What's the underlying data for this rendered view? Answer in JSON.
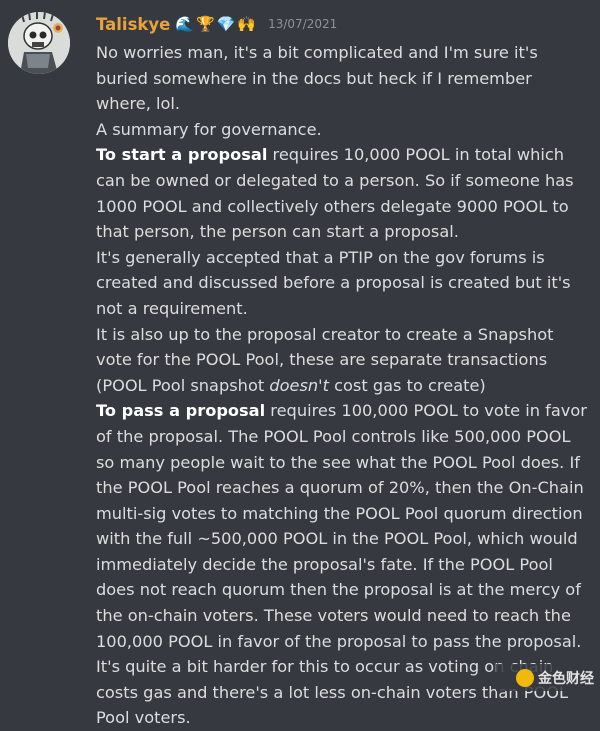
{
  "message": {
    "username": "Taliskye",
    "badges": [
      "🌊",
      "🏆",
      "💎",
      "🙌"
    ],
    "timestamp": "13/07/2021",
    "colors": {
      "username": "#e8a33d",
      "text": "#dcddde",
      "background": "#36393f",
      "timestamp": "#8e9297"
    },
    "avatar_icon": "skull-avatar",
    "lines": {
      "l1": "No worries man, it's a bit complicated and I'm sure it's buried somewhere in the docs but heck if I remember where, lol.",
      "l2": "A summary for governance.",
      "p1_bold": "To start a proposal",
      "p1_rest": " requires 10,000 POOL in total which can be owned or delegated to a person. So if someone has 1000 POOL and collectively others delegate 9000 POOL to that person, the person can start a proposal.",
      "p2": "It's generally accepted that a PTIP on the gov forums is created and discussed before a proposal is created but it's not a requirement.",
      "p3_a": "It is also up to the proposal creator to create a Snapshot vote for the POOL Pool, these are separate transactions (POOL Pool snapshot ",
      "p3_italic": "doesn't",
      "p3_b": " cost gas to create)",
      "p4_bold": "To pass a proposal",
      "p4_rest": " requires 100,000 POOL to vote in favor of the proposal. The POOL Pool controls like 500,000 POOL so many people wait to the see what the POOL Pool does. If the POOL Pool reaches a quorum of 20%, then the On-Chain multi-sig votes to matching the POOL Pool quorum direction with the full ~500,000 POOL in the POOL Pool, which would immediately decide the proposal's fate. If the POOL Pool does not reach quorum then the proposal is at the mercy of the on-chain voters. These voters would need to reach the 100,000 POOL in favor of the proposal to pass the proposal. It's quite a bit harder for this to occur as voting on chain costs gas and there's a lot less on-chain voters than POOL Pool voters."
    }
  },
  "watermark": {
    "text": "金色财经",
    "logo_icon": "coin-logo"
  }
}
